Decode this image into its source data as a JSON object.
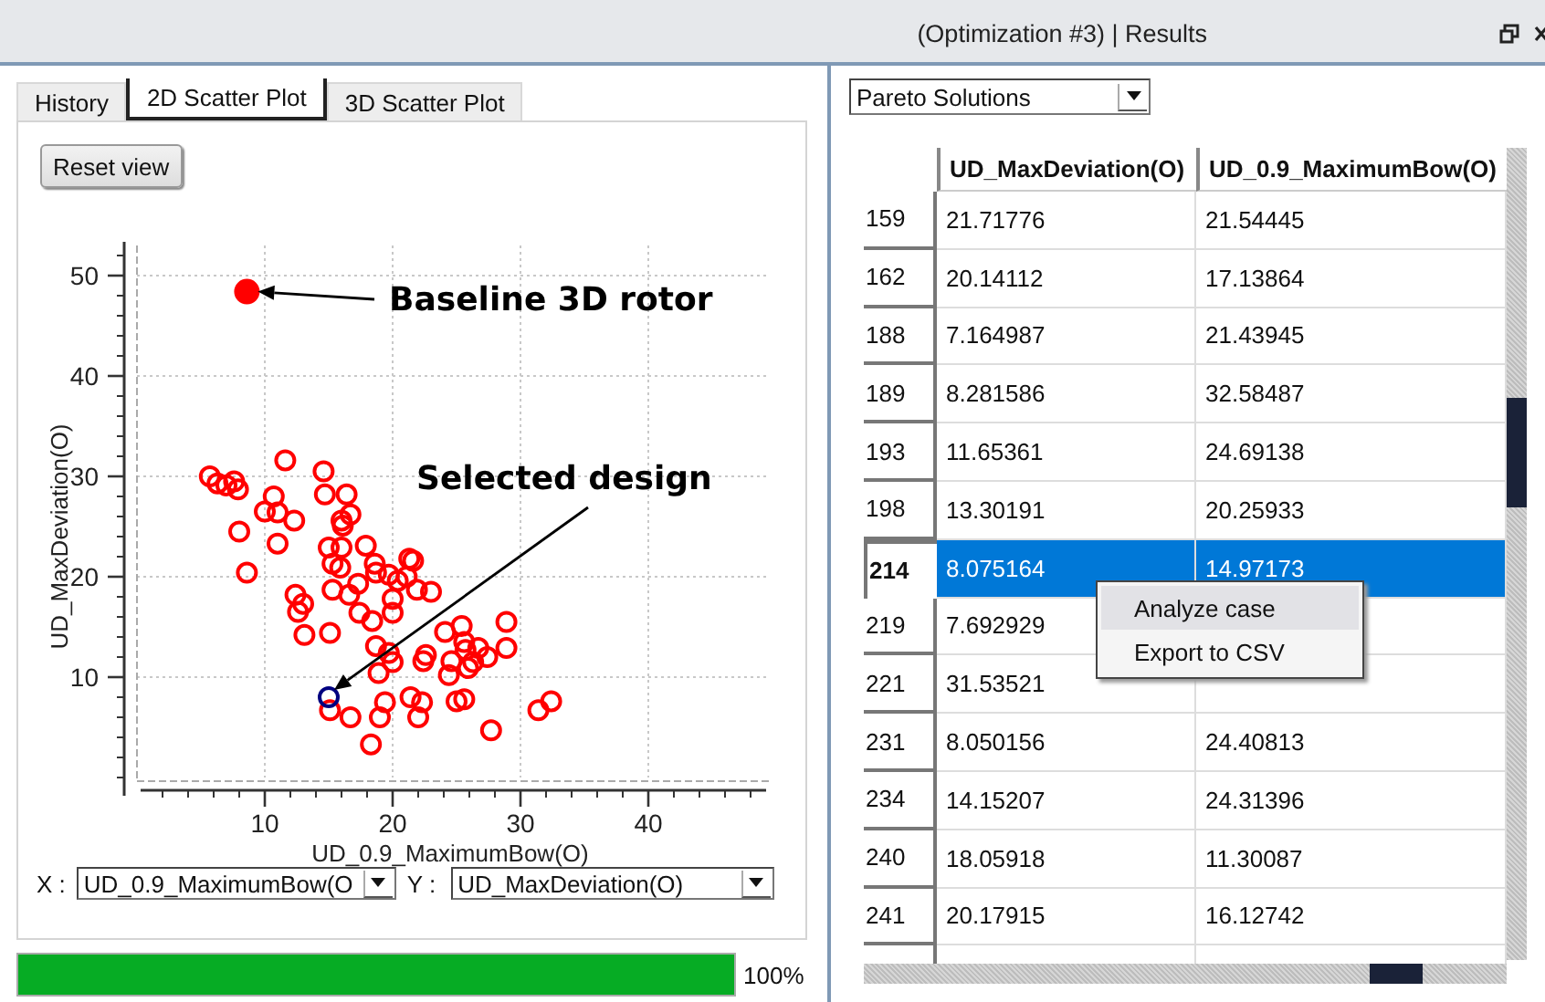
{
  "window": {
    "title": "(Optimization #3) | Results"
  },
  "left": {
    "tabs": [
      {
        "label": "History",
        "selected": false
      },
      {
        "label": "2D Scatter Plot",
        "selected": true
      },
      {
        "label": "3D Scatter Plot",
        "selected": false
      }
    ],
    "reset_button": "Reset view",
    "chart_data": {
      "type": "scatter",
      "xlabel": "UD_0.9_MaximumBow(O)",
      "ylabel": "UD_MaxDeviation(O)",
      "xlim": [
        0,
        49.5
      ],
      "ylim": [
        0,
        53
      ],
      "grid": true,
      "xticks": [
        10,
        20,
        30,
        40
      ],
      "yticks": [
        10,
        20,
        30,
        40,
        50
      ],
      "series": [
        {
          "color": "#ff0000",
          "x": [
            5.7,
            6.3,
            7.0,
            7.6,
            7.9,
            8.0,
            8.6,
            10.0,
            10.7,
            11.0,
            11.0,
            11.6,
            12.3,
            12.4,
            12.6,
            13.0,
            13.1,
            14.6,
            14.7,
            15.0,
            15.1,
            15.3,
            15.3,
            15.9,
            16.0,
            16.0,
            16.1,
            16.4,
            16.7,
            16.6,
            17.3,
            17.4,
            17.9,
            18.6,
            18.7,
            18.7,
            18.4,
            18.9,
            19.4,
            19.7,
            20.0,
            20.0,
            19.7,
            20.0,
            20.4,
            21.1,
            21.3,
            21.6,
            21.9,
            22.0,
            22.3,
            21.4,
            22.4,
            22.6,
            23.0,
            24.1,
            24.4,
            24.6,
            25.4,
            25.6,
            25.7,
            25.0,
            25.6,
            25.9,
            26.3,
            26.7,
            27.4,
            27.7,
            28.9,
            28.9,
            31.4,
            32.4,
            18.3,
            19.0,
            15.1,
            16.7
          ],
          "values": [
            30.0,
            29.3,
            29.1,
            29.5,
            28.7,
            24.5,
            20.4,
            26.5,
            28.0,
            26.4,
            23.3,
            31.6,
            25.6,
            18.2,
            16.5,
            17.3,
            14.2,
            30.5,
            28.2,
            22.9,
            14.4,
            18.7,
            21.3,
            20.9,
            22.9,
            25.6,
            25.1,
            28.2,
            26.2,
            18.2,
            19.3,
            16.4,
            23.1,
            21.3,
            20.4,
            13.1,
            15.6,
            10.4,
            7.5,
            20.2,
            17.8,
            16.4,
            12.4,
            11.5,
            19.6,
            20.0,
            21.8,
            21.6,
            18.7,
            6.0,
            7.5,
            8.0,
            11.6,
            12.2,
            18.5,
            14.5,
            10.2,
            11.6,
            15.1,
            13.5,
            12.7,
            7.6,
            7.8,
            10.9,
            11.5,
            12.9,
            12.0,
            4.7,
            15.5,
            12.9,
            6.7,
            7.6,
            3.3,
            6.0,
            6.7,
            6.0
          ]
        },
        {
          "color": "#000080",
          "x": [
            15.0
          ],
          "values": [
            8.0
          ]
        },
        {
          "color": "#ff0000",
          "x": [
            8.6
          ],
          "values": [
            48.4
          ]
        }
      ],
      "annotations": [
        "Baseline 3D rotor",
        "Selected design"
      ]
    },
    "markers": [
      {
        "kind": "hollow"
      },
      {
        "kind": "hollow"
      },
      {
        "kind": "filled"
      }
    ],
    "x_select": {
      "label": "X :",
      "value": "UD_0.9_MaximumBow(O"
    },
    "y_select": {
      "label": "Y :",
      "value": "UD_MaxDeviation(O)"
    },
    "progress": {
      "level": 1,
      "reading": "100%"
    }
  },
  "right": {
    "dropdown": "Pareto Solutions",
    "table": {
      "columns": [
        "UD_MaxDeviation(O)",
        "UD_0.9_MaximumBow(O)"
      ],
      "rows": [
        {
          "id": "159",
          "cells": [
            "21.71776",
            "21.54445"
          ],
          "selected": false
        },
        {
          "id": "162",
          "cells": [
            "20.14112",
            "17.13864"
          ],
          "selected": false
        },
        {
          "id": "188",
          "cells": [
            "7.164987",
            "21.43945"
          ],
          "selected": false
        },
        {
          "id": "189",
          "cells": [
            "8.281586",
            "32.58487"
          ],
          "selected": false
        },
        {
          "id": "193",
          "cells": [
            "11.65361",
            "24.69138"
          ],
          "selected": false
        },
        {
          "id": "198",
          "cells": [
            "13.30191",
            "20.25933"
          ],
          "selected": false
        },
        {
          "id": "214",
          "cells": [
            "8.075164",
            "14.97173"
          ],
          "selected": true
        },
        {
          "id": "219",
          "cells": [
            "7.692929"
          ],
          "selected": false
        },
        {
          "id": "221",
          "cells": [
            "31.53521"
          ],
          "selected": false
        },
        {
          "id": "231",
          "cells": [
            "8.050156",
            "24.40813"
          ],
          "selected": false
        },
        {
          "id": "234",
          "cells": [
            "14.15207",
            "24.31396"
          ],
          "selected": false
        },
        {
          "id": "240",
          "cells": [
            "18.05918",
            "11.30087"
          ],
          "selected": false
        },
        {
          "id": "241",
          "cells": [
            "20.17915",
            "16.12742"
          ],
          "selected": false
        }
      ]
    },
    "context_menu": [
      {
        "label": "Analyze case",
        "selected": true
      },
      {
        "label": "Export to CSV",
        "selected": false
      }
    ]
  }
}
